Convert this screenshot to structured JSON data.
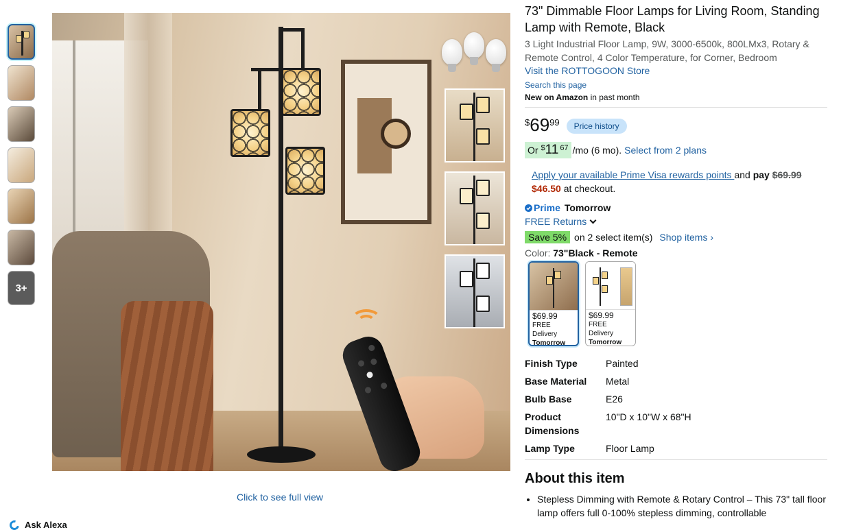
{
  "thumbnails": {
    "count": 7,
    "more_label": "3+"
  },
  "main_image": {
    "full_view_label": "Click to see full view"
  },
  "alexa": {
    "label": "Ask Alexa"
  },
  "product": {
    "title": "73\" Dimmable Floor Lamps for Living Room, Standing Lamp with Remote, Black",
    "subtitle": "3 Light Industrial Floor Lamp, 9W, 3000-6500k, 800LMx3, Rotary & Remote Control, 4 Color Temperature, for Corner, Bedroom",
    "store_link": "Visit the ROTTOGOON Store",
    "search_page": "Search this page",
    "new_on_bold": "New on Amazon",
    "new_on_rest": " in past month"
  },
  "price": {
    "symbol": "$",
    "whole": "69",
    "fraction": "99",
    "history_label": "Price history"
  },
  "monthly": {
    "prefix": "Or ",
    "symbol": "$",
    "whole": "11",
    "fraction": "67",
    "suffix": "/mo (6 mo).",
    "plans_link": "Select from 2 plans"
  },
  "prime_visa": {
    "link": "Apply your available Prime Visa rewards points ",
    "and_pay": "and ",
    "pay": "pay",
    "old_price": "$69.99",
    "new_price": "$46.50",
    "checkout": " at checkout."
  },
  "delivery": {
    "prime_label": "Prime",
    "tomorrow": "Tomorrow",
    "returns": "FREE Returns"
  },
  "savings": {
    "badge": "Save 5%",
    "text": "on 2 select item(s)",
    "link": "Shop items ›"
  },
  "color": {
    "label": "Color: ",
    "value": "73\"Black - Remote",
    "options": [
      {
        "price": "$69.99",
        "delivery": "FREE Delivery",
        "when": "Tomorrow"
      },
      {
        "price": "$69.99",
        "delivery": "FREE Delivery",
        "when": "Tomorrow"
      }
    ]
  },
  "specs": [
    {
      "key": "Finish Type",
      "value": "Painted"
    },
    {
      "key": "Base Material",
      "value": "Metal"
    },
    {
      "key": "Bulb Base",
      "value": "E26"
    },
    {
      "key": "Product Dimensions",
      "value": "10\"D x 10\"W x 68\"H"
    },
    {
      "key": "Lamp Type",
      "value": "Floor Lamp"
    }
  ],
  "about": {
    "heading": "About this item",
    "bullets": [
      "Stepless Dimming with Remote & Rotary Control – This 73\" tall floor lamp offers full 0-100% stepless dimming, controllable"
    ]
  },
  "colors": {
    "link": "#2162a1",
    "price_history_bg": "#c8e3fa",
    "save_badge": "#7fda69",
    "red_price": "#b12704"
  }
}
